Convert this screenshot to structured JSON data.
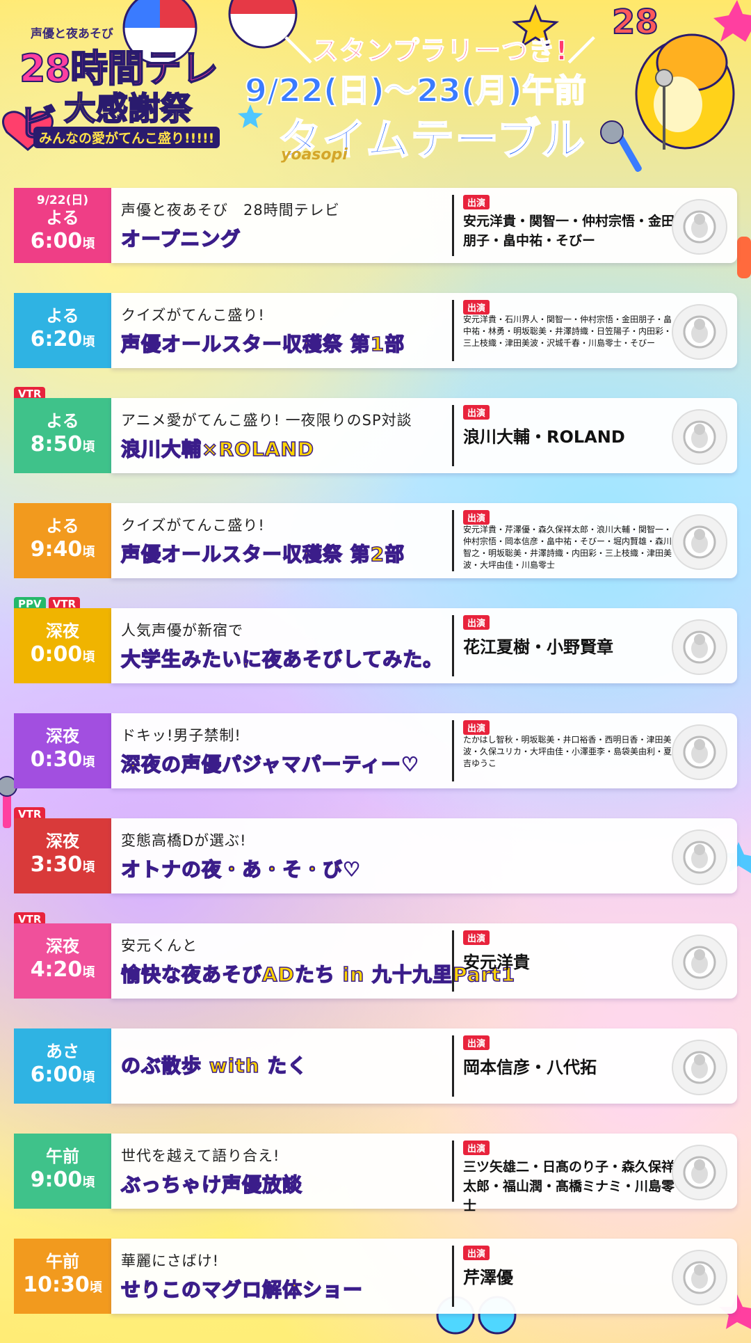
{
  "header": {
    "logo_top": "声優と夜あそび",
    "logo_main": "28時間テレビ",
    "logo_sub": "大感謝祭",
    "logo_tag": "みんなの愛がてんこ盛り!!!!!",
    "stamp_rally": "＼スタンプラリーつき!／",
    "dates": "9/22(日)〜23(月)午前",
    "title": "タイムテーブル",
    "brand": "yoasopi",
    "corner_number": "28"
  },
  "cast_label": "出演",
  "colors": {
    "pink": "#ef3e86",
    "blue": "#2fb3e3",
    "green": "#3fc28a",
    "orange": "#f29a1e",
    "yellow": "#f0b400",
    "purple": "#a24fe0",
    "red": "#d93a3a",
    "magenta": "#f0509b"
  },
  "programs": [
    {
      "badges": [],
      "date": "9/22(日)",
      "period": "よる",
      "time": "6:00",
      "suffix": "頃",
      "color": "#ef3e86",
      "subtitle": "声優と夜あそび　28時間テレビ",
      "title": "オープニング",
      "cast": "安元洋貴・関智一・仲村宗悟・金田朋子・畠中祐・そびー",
      "cast_size": "normal"
    },
    {
      "badges": [],
      "date": "",
      "period": "よる",
      "time": "6:20",
      "suffix": "頃",
      "color": "#2fb3e3",
      "subtitle": "クイズがてんこ盛り!",
      "title": "声優オールスター収穫祭 第1部",
      "cast": "安元洋貴・石川界人・関智一・仲村宗悟・金田朋子・畠中祐・林勇・明坂聡美・井澤詩織・日笠陽子・内田彩・三上枝織・津田美波・沢城千春・川島零士・そびー",
      "cast_size": "small"
    },
    {
      "badges": [
        "VTR"
      ],
      "date": "",
      "period": "よる",
      "time": "8:50",
      "suffix": "頃",
      "color": "#3fc28a",
      "subtitle": "アニメ愛がてんこ盛り! 一夜限りのSP対談",
      "title": "浪川大輔×ROLAND",
      "cast": "浪川大輔・ROLAND",
      "cast_size": "big"
    },
    {
      "badges": [],
      "date": "",
      "period": "よる",
      "time": "9:40",
      "suffix": "頃",
      "color": "#f29a1e",
      "subtitle": "クイズがてんこ盛り!",
      "title": "声優オールスター収穫祭 第2部",
      "cast": "安元洋貴・芹澤優・森久保祥太郎・浪川大輔・関智一・仲村宗悟・岡本信彦・畠中祐・そびー・堀内賢雄・森川智之・明坂聡美・井澤詩織・内田彩・三上枝織・津田美波・大坪由佳・川島零士",
      "cast_size": "small"
    },
    {
      "badges": [
        "PPV",
        "VTR"
      ],
      "date": "",
      "period": "深夜",
      "time": "0:00",
      "suffix": "頃",
      "color": "#f0b400",
      "subtitle": "人気声優が新宿で",
      "title": "大学生みたいに夜あそびしてみた。",
      "cast": "花江夏樹・小野賢章",
      "cast_size": "big"
    },
    {
      "badges": [],
      "date": "",
      "period": "深夜",
      "time": "0:30",
      "suffix": "頃",
      "color": "#a24fe0",
      "subtitle": "ドキッ!男子禁制!",
      "title": "深夜の声優パジャマパーティー♡",
      "cast": "たかはし智秋・明坂聡美・井口裕香・西明日香・津田美波・久保ユリカ・大坪由佳・小澤亜李・島袋美由利・夏吉ゆうこ",
      "cast_size": "small"
    },
    {
      "badges": [
        "VTR"
      ],
      "date": "",
      "period": "深夜",
      "time": "3:30",
      "suffix": "頃",
      "color": "#d93a3a",
      "subtitle": "変態高橋Dが選ぶ!",
      "title": "オトナの夜・あ・そ・び♡",
      "cast": "",
      "cast_size": "none"
    },
    {
      "badges": [
        "VTR"
      ],
      "date": "",
      "period": "深夜",
      "time": "4:20",
      "suffix": "頃",
      "color": "#f0509b",
      "subtitle": "安元くんと",
      "title": "愉快な夜あそびADたち in 九十九里Part1",
      "cast": "安元洋貴",
      "cast_size": "big"
    },
    {
      "badges": [],
      "date": "",
      "period": "あさ",
      "time": "6:00",
      "suffix": "頃",
      "color": "#2fb3e3",
      "subtitle": "",
      "title": "のぶ散歩 with たく",
      "cast": "岡本信彦・八代拓",
      "cast_size": "big"
    },
    {
      "badges": [],
      "date": "",
      "period": "午前",
      "time": "9:00",
      "suffix": "頃",
      "color": "#3fc28a",
      "subtitle": "世代を越えて語り合え!",
      "title": "ぶっちゃけ声優放談",
      "cast": "三ツ矢雄二・日髙のり子・森久保祥太郎・福山潤・髙橋ミナミ・川島零士",
      "cast_size": "normal"
    },
    {
      "badges": [],
      "date": "",
      "period": "午前",
      "time": "10:30",
      "suffix": "頃",
      "color": "#f29a1e",
      "subtitle": "華麗にさばけ!",
      "title": "せりこのマグロ解体ショー",
      "cast": "芹澤優",
      "cast_size": "big"
    }
  ]
}
